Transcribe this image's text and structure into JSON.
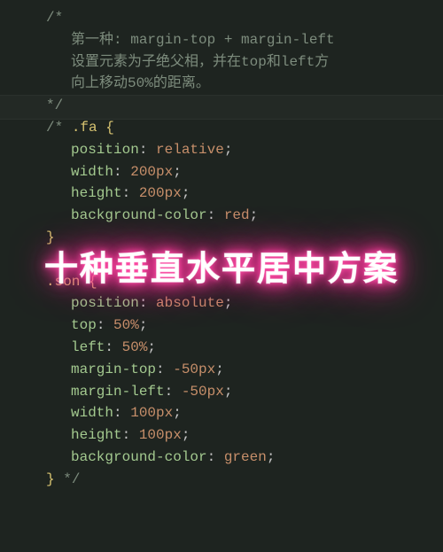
{
  "code": {
    "open_comment": "/*",
    "desc_line1_a": "第一种: ",
    "desc_line1_b": "margin-top + margin-left",
    "desc_line2_a": "设置元素为子绝父相，并在",
    "desc_line2_b": "top",
    "desc_line2_c": "和",
    "desc_line2_d": "left",
    "desc_line2_e": "方",
    "desc_line3_a": "向上移动",
    "desc_line3_b": "50%",
    "desc_line3_c": "的距离。",
    "close_comment": "*/",
    "sel1_prefix": "/* ",
    "sel1": ".fa",
    "brace_open": " {",
    "p_position": "position",
    "colon_sp": ": ",
    "v_relative": "relative",
    "semicolon": ";",
    "p_width": "width",
    "v_200px": "200px",
    "p_height": "height",
    "p_bgcolor": "background-color",
    "v_red": "red",
    "brace_close": "}",
    "sel2": ".son",
    "v_absolute": "absolute",
    "p_top": "top",
    "v_50pct": "50%",
    "p_left": "left",
    "p_margin_top": "margin-top",
    "v_neg50px": "-50px",
    "p_margin_left": "margin-left",
    "v_100px": "100px",
    "v_green": "green",
    "tail_comment": " */"
  },
  "overlay": {
    "title": "十种垂直水平居中方案"
  },
  "chart_data": null
}
